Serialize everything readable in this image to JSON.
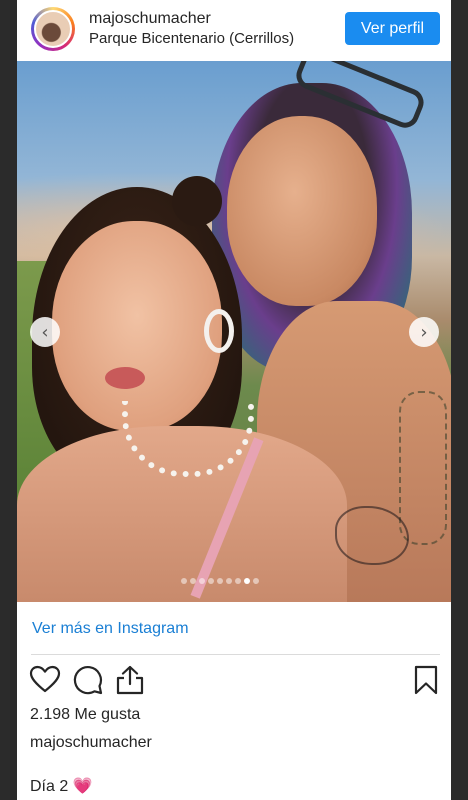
{
  "post": {
    "username": "majoschumacher",
    "location": "Parque Bicentenario (Cerrillos)",
    "view_profile_label": "Ver perfil",
    "image_alt": "Selfie of two friends at sunset in a park",
    "carousel": {
      "count": 9,
      "active_index": 7
    },
    "more_link": "Ver más en Instagram",
    "likes": "2.198 Me gusta",
    "caption_username": "majoschumacher",
    "caption_text": "Día 2",
    "caption_emoji": "💗"
  },
  "icons": {
    "like": "heart-icon",
    "comment": "comment-bubble-icon",
    "share": "share-icon",
    "save": "bookmark-icon",
    "prev": "chevron-left-icon",
    "next": "chevron-right-icon"
  },
  "colors": {
    "accent": "#1a8cf0",
    "link": "#1a7fd4",
    "text": "#262626",
    "divider": "#dbdbdb"
  }
}
